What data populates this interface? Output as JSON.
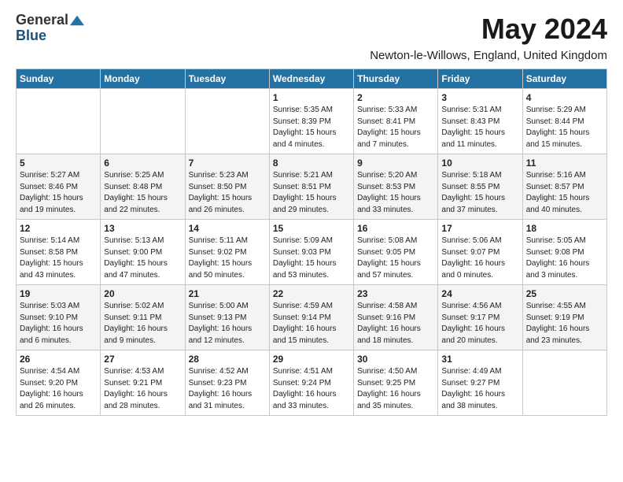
{
  "logo": {
    "general": "General",
    "blue": "Blue"
  },
  "title": "May 2024",
  "location": "Newton-le-Willows, England, United Kingdom",
  "headers": [
    "Sunday",
    "Monday",
    "Tuesday",
    "Wednesday",
    "Thursday",
    "Friday",
    "Saturday"
  ],
  "weeks": [
    [
      {
        "day": "",
        "info": ""
      },
      {
        "day": "",
        "info": ""
      },
      {
        "day": "",
        "info": ""
      },
      {
        "day": "1",
        "info": "Sunrise: 5:35 AM\nSunset: 8:39 PM\nDaylight: 15 hours\nand 4 minutes."
      },
      {
        "day": "2",
        "info": "Sunrise: 5:33 AM\nSunset: 8:41 PM\nDaylight: 15 hours\nand 7 minutes."
      },
      {
        "day": "3",
        "info": "Sunrise: 5:31 AM\nSunset: 8:43 PM\nDaylight: 15 hours\nand 11 minutes."
      },
      {
        "day": "4",
        "info": "Sunrise: 5:29 AM\nSunset: 8:44 PM\nDaylight: 15 hours\nand 15 minutes."
      }
    ],
    [
      {
        "day": "5",
        "info": "Sunrise: 5:27 AM\nSunset: 8:46 PM\nDaylight: 15 hours\nand 19 minutes."
      },
      {
        "day": "6",
        "info": "Sunrise: 5:25 AM\nSunset: 8:48 PM\nDaylight: 15 hours\nand 22 minutes."
      },
      {
        "day": "7",
        "info": "Sunrise: 5:23 AM\nSunset: 8:50 PM\nDaylight: 15 hours\nand 26 minutes."
      },
      {
        "day": "8",
        "info": "Sunrise: 5:21 AM\nSunset: 8:51 PM\nDaylight: 15 hours\nand 29 minutes."
      },
      {
        "day": "9",
        "info": "Sunrise: 5:20 AM\nSunset: 8:53 PM\nDaylight: 15 hours\nand 33 minutes."
      },
      {
        "day": "10",
        "info": "Sunrise: 5:18 AM\nSunset: 8:55 PM\nDaylight: 15 hours\nand 37 minutes."
      },
      {
        "day": "11",
        "info": "Sunrise: 5:16 AM\nSunset: 8:57 PM\nDaylight: 15 hours\nand 40 minutes."
      }
    ],
    [
      {
        "day": "12",
        "info": "Sunrise: 5:14 AM\nSunset: 8:58 PM\nDaylight: 15 hours\nand 43 minutes."
      },
      {
        "day": "13",
        "info": "Sunrise: 5:13 AM\nSunset: 9:00 PM\nDaylight: 15 hours\nand 47 minutes."
      },
      {
        "day": "14",
        "info": "Sunrise: 5:11 AM\nSunset: 9:02 PM\nDaylight: 15 hours\nand 50 minutes."
      },
      {
        "day": "15",
        "info": "Sunrise: 5:09 AM\nSunset: 9:03 PM\nDaylight: 15 hours\nand 53 minutes."
      },
      {
        "day": "16",
        "info": "Sunrise: 5:08 AM\nSunset: 9:05 PM\nDaylight: 15 hours\nand 57 minutes."
      },
      {
        "day": "17",
        "info": "Sunrise: 5:06 AM\nSunset: 9:07 PM\nDaylight: 16 hours\nand 0 minutes."
      },
      {
        "day": "18",
        "info": "Sunrise: 5:05 AM\nSunset: 9:08 PM\nDaylight: 16 hours\nand 3 minutes."
      }
    ],
    [
      {
        "day": "19",
        "info": "Sunrise: 5:03 AM\nSunset: 9:10 PM\nDaylight: 16 hours\nand 6 minutes."
      },
      {
        "day": "20",
        "info": "Sunrise: 5:02 AM\nSunset: 9:11 PM\nDaylight: 16 hours\nand 9 minutes."
      },
      {
        "day": "21",
        "info": "Sunrise: 5:00 AM\nSunset: 9:13 PM\nDaylight: 16 hours\nand 12 minutes."
      },
      {
        "day": "22",
        "info": "Sunrise: 4:59 AM\nSunset: 9:14 PM\nDaylight: 16 hours\nand 15 minutes."
      },
      {
        "day": "23",
        "info": "Sunrise: 4:58 AM\nSunset: 9:16 PM\nDaylight: 16 hours\nand 18 minutes."
      },
      {
        "day": "24",
        "info": "Sunrise: 4:56 AM\nSunset: 9:17 PM\nDaylight: 16 hours\nand 20 minutes."
      },
      {
        "day": "25",
        "info": "Sunrise: 4:55 AM\nSunset: 9:19 PM\nDaylight: 16 hours\nand 23 minutes."
      }
    ],
    [
      {
        "day": "26",
        "info": "Sunrise: 4:54 AM\nSunset: 9:20 PM\nDaylight: 16 hours\nand 26 minutes."
      },
      {
        "day": "27",
        "info": "Sunrise: 4:53 AM\nSunset: 9:21 PM\nDaylight: 16 hours\nand 28 minutes."
      },
      {
        "day": "28",
        "info": "Sunrise: 4:52 AM\nSunset: 9:23 PM\nDaylight: 16 hours\nand 31 minutes."
      },
      {
        "day": "29",
        "info": "Sunrise: 4:51 AM\nSunset: 9:24 PM\nDaylight: 16 hours\nand 33 minutes."
      },
      {
        "day": "30",
        "info": "Sunrise: 4:50 AM\nSunset: 9:25 PM\nDaylight: 16 hours\nand 35 minutes."
      },
      {
        "day": "31",
        "info": "Sunrise: 4:49 AM\nSunset: 9:27 PM\nDaylight: 16 hours\nand 38 minutes."
      },
      {
        "day": "",
        "info": ""
      }
    ]
  ]
}
